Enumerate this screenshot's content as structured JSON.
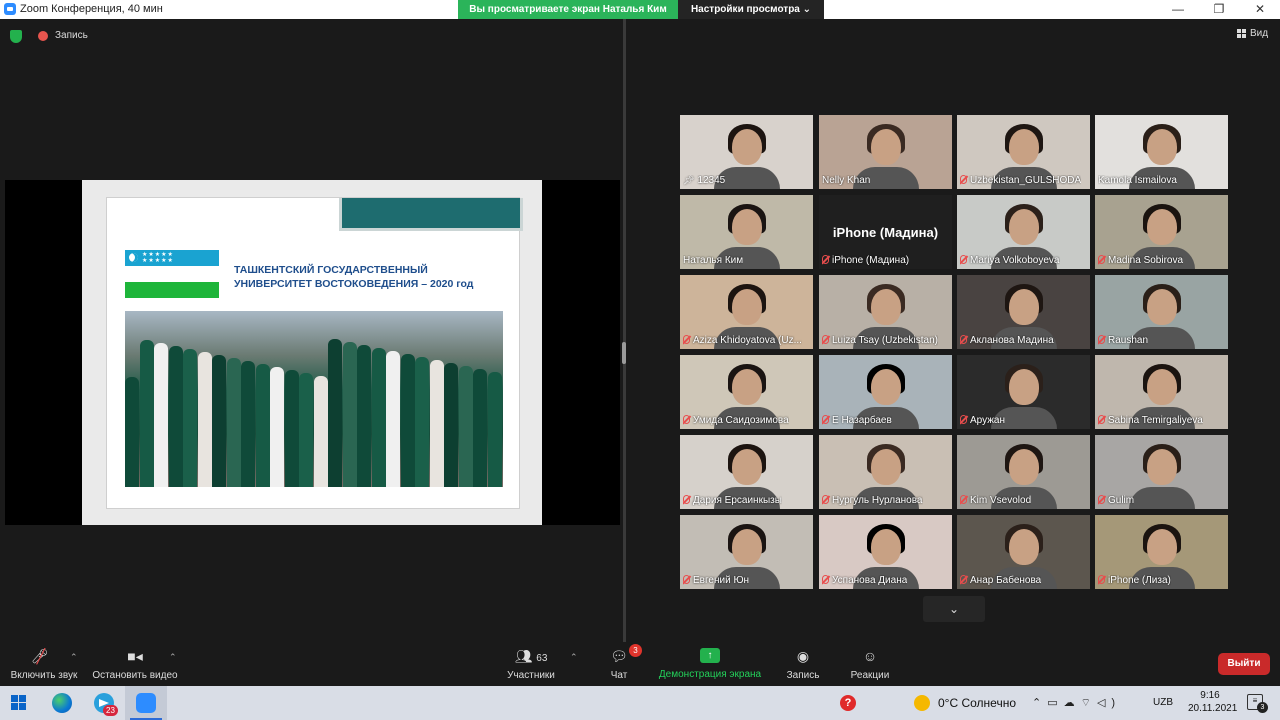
{
  "window": {
    "title": "Zoom Конференция, 40 мин",
    "share_banner": "Вы просматриваете экран Наталья Ким",
    "view_options": "Настройки просмотра ⌄",
    "minimize": "—",
    "maximize": "❐",
    "close": "✕"
  },
  "top_bar": {
    "recording_label": "Запись",
    "view_label": "Вид"
  },
  "slide": {
    "title_line1": "ТАШКЕНТСКИЙ ГОСУДАРСТВЕННЫЙ",
    "title_line2": "УНИВЕРСИТЕТ ВОСТОКОВЕДЕНИЯ – 2020 год"
  },
  "participants": [
    {
      "name": "12345",
      "pinned": true,
      "muted": false
    },
    {
      "name": "Nelly Khan",
      "muted": false
    },
    {
      "name": "Uzbekistan_GULSHODA",
      "muted": true
    },
    {
      "name": "Kamola Ismailova",
      "muted": false
    },
    {
      "name": "Наталья Ким",
      "muted": false,
      "active": true
    },
    {
      "name": "iPhone (Мадина)",
      "muted": true,
      "video_off": true,
      "big_label": "iPhone (Мадина)"
    },
    {
      "name": "Mariya Volkoboyeva",
      "muted": true
    },
    {
      "name": "Madina Sobirova",
      "muted": true
    },
    {
      "name": "Aziza Khidoyatova (Uz...",
      "muted": true
    },
    {
      "name": "Luiza Tsay (Uzbekistan)",
      "muted": true
    },
    {
      "name": "Акланова Мадина",
      "muted": true
    },
    {
      "name": "Raushan",
      "muted": true
    },
    {
      "name": "Умида Саидозимова",
      "muted": true
    },
    {
      "name": "Е Назарбаев",
      "muted": true
    },
    {
      "name": "Аружан",
      "muted": true
    },
    {
      "name": "Sabina Temirgaliyeva",
      "muted": true
    },
    {
      "name": "Дария Ерсаинкызы",
      "muted": true
    },
    {
      "name": "Нургуль Нурланова",
      "muted": true
    },
    {
      "name": "Kim Vsevolod",
      "muted": true
    },
    {
      "name": "Gulim",
      "muted": true
    },
    {
      "name": "Евгений Юн",
      "muted": true
    },
    {
      "name": "Успанова Диана",
      "muted": true
    },
    {
      "name": "Анар Бабенова",
      "muted": true
    },
    {
      "name": "iPhone (Лиза)",
      "muted": true
    }
  ],
  "toolbar": {
    "unmute": "Включить звук",
    "stop_video": "Остановить видео",
    "participants_label": "Участники",
    "participants_count": "63",
    "chat_label": "Чат",
    "chat_badge": "3",
    "share_screen": "Демонстрация экрана",
    "record": "Запись",
    "reactions": "Реакции",
    "leave": "Выйти"
  },
  "taskbar": {
    "telegram_badge": "23",
    "weather": "0°C  Солнечно",
    "language": "UZB",
    "time": "9:16",
    "date": "20.11.2021",
    "notifications": "3"
  },
  "colors": {
    "share_green": "#2bb45a",
    "leave_red": "#c92a2a",
    "active_speaker": "#e2e54e",
    "muted_red": "#e84d4d"
  }
}
